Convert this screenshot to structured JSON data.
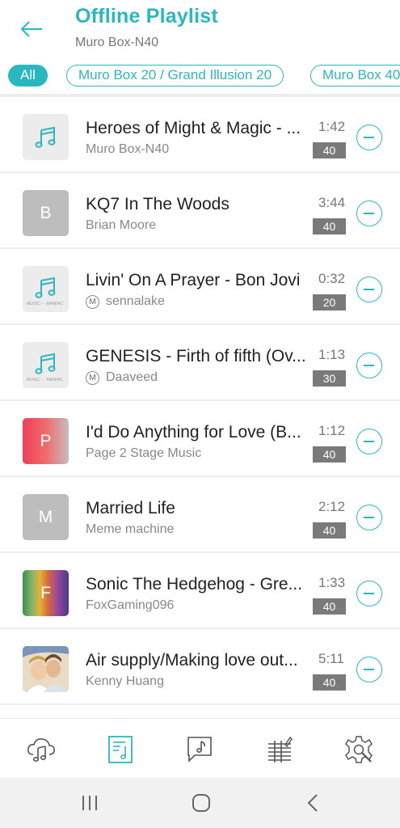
{
  "header": {
    "title": "Offline Playlist",
    "subtitle": "Muro Box-N40"
  },
  "filters": [
    {
      "label": "All",
      "active": true
    },
    {
      "label": "Muro Box 20 / Grand Illusion 20",
      "active": false
    },
    {
      "label": "Muro Box 40",
      "active": false
    }
  ],
  "songs": [
    {
      "title": "Heroes of Might & Magic - ...",
      "artist": "Muro Box-N40",
      "duration": "1:42",
      "box": "40",
      "thumb": "music-note-icon",
      "marked": false
    },
    {
      "title": "KQ7 In The Woods",
      "artist": "Brian Moore",
      "duration": "3:44",
      "box": "40",
      "thumb_letter": "B",
      "marked": false
    },
    {
      "title": "Livin' On A Prayer - Bon Jovi",
      "artist": "sennalake",
      "duration": "0:32",
      "box": "20",
      "thumb": "music-note-icon",
      "marked": true
    },
    {
      "title": "GENESIS - Firth of fifth (Ov...",
      "artist": "Daaveed",
      "duration": "1:13",
      "box": "30",
      "thumb": "music-note-icon",
      "marked": true
    },
    {
      "title": "I'd Do Anything for Love (B...",
      "artist": "Page 2 Stage Music",
      "duration": "1:12",
      "box": "40",
      "thumb_letter": "P",
      "marked": false
    },
    {
      "title": "Married Life",
      "artist": "Meme machine",
      "duration": "2:12",
      "box": "40",
      "thumb_letter": "M",
      "marked": false
    },
    {
      "title": "Sonic The Hedgehog - Gre...",
      "artist": "FoxGaming096",
      "duration": "1:33",
      "box": "40",
      "thumb_letter": "F",
      "marked": false
    },
    {
      "title": "Air supply/Making love out...",
      "artist": "Kenny Huang",
      "duration": "5:11",
      "box": "40",
      "thumb": "album-art",
      "marked": false
    }
  ],
  "marker_letter": "M",
  "nav": [
    {
      "name": "cloud-music-icon",
      "active": false
    },
    {
      "name": "playlist-icon",
      "active": true
    },
    {
      "name": "message-music-icon",
      "active": false
    },
    {
      "name": "equalizer-icon",
      "active": false
    },
    {
      "name": "settings-icon",
      "active": false
    }
  ],
  "colors": {
    "accent": "#2ab8bf",
    "badge": "#7a7a7a",
    "divider": "#ededed"
  }
}
